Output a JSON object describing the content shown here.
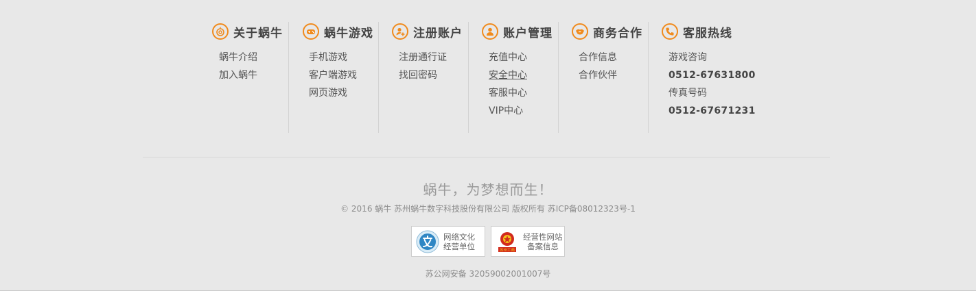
{
  "columns": [
    {
      "title": "关于蜗牛",
      "icon": "snail-icon",
      "links": [
        "蜗牛介绍",
        "加入蜗牛"
      ]
    },
    {
      "title": "蜗牛游戏",
      "icon": "gamepad-icon",
      "links": [
        "手机游戏",
        "客户端游戏",
        "网页游戏"
      ]
    },
    {
      "title": "注册账户",
      "icon": "add-user-icon",
      "links": [
        "注册通行证",
        "找回密码"
      ]
    },
    {
      "title": "账户管理",
      "icon": "user-icon",
      "links": [
        "充值中心",
        "安全中心",
        "客服中心",
        "VIP中心"
      ]
    },
    {
      "title": "商务合作",
      "icon": "handshake-icon",
      "links": [
        "合作信息",
        "合作伙伴"
      ]
    },
    {
      "title": "客服热线",
      "icon": "phone-icon",
      "links": [
        "游戏咨询",
        "0512-67631800",
        "传真号码",
        "0512-67671231"
      ]
    }
  ],
  "footer": {
    "slogan": "蜗牛，为梦想而生！",
    "copyright": "© 2016 蜗牛 苏州蜗牛数字科技股份有限公司 版权所有 苏ICP备08012323号-1",
    "police_record": "苏公网安备 32059002001007号"
  },
  "badges": [
    {
      "icon": "culture-license-icon",
      "line1": "网络文化",
      "line2": "经营单位"
    },
    {
      "icon": "business-emblem-icon",
      "line1": "经营性网站",
      "line2": "备案信息",
      "emblem_text": "苏州工商"
    }
  ],
  "colors": {
    "accent": "#f08a1c",
    "background": "#e8e8e8"
  }
}
